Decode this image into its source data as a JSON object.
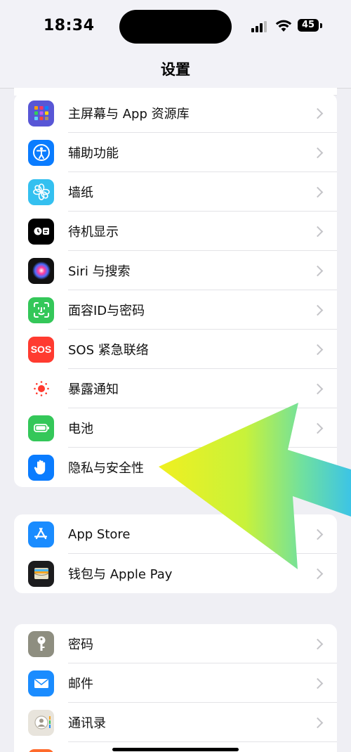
{
  "status_bar": {
    "time": "18:34",
    "battery": "45"
  },
  "nav": {
    "title": "设置"
  },
  "groups": [
    {
      "rows": [
        {
          "label": "主屏幕与 App 资源库",
          "icon": "home-screen-icon"
        },
        {
          "label": "辅助功能",
          "icon": "accessibility-icon"
        },
        {
          "label": "墙纸",
          "icon": "wallpaper-icon"
        },
        {
          "label": "待机显示",
          "icon": "standby-icon"
        },
        {
          "label": "Siri 与搜索",
          "icon": "siri-icon"
        },
        {
          "label": "面容ID与密码",
          "icon": "face-id-icon"
        },
        {
          "label": "SOS 紧急联络",
          "icon": "sos-icon",
          "icon_text": "SOS"
        },
        {
          "label": "暴露通知",
          "icon": "exposure-icon"
        },
        {
          "label": "电池",
          "icon": "battery-icon"
        },
        {
          "label": "隐私与安全性",
          "icon": "privacy-hand-icon"
        }
      ]
    },
    {
      "rows": [
        {
          "label": "App Store",
          "icon": "app-store-icon"
        },
        {
          "label": "钱包与 Apple Pay",
          "icon": "wallet-icon"
        }
      ]
    },
    {
      "rows": [
        {
          "label": "密码",
          "icon": "key-icon"
        },
        {
          "label": "邮件",
          "icon": "mail-icon"
        },
        {
          "label": "通讯录",
          "icon": "contacts-icon"
        }
      ]
    }
  ],
  "colors": {
    "accent_blue": "#1a7cf5",
    "arrow_yellow": "#e6f22a",
    "arrow_cyan": "#3cc9e0"
  }
}
